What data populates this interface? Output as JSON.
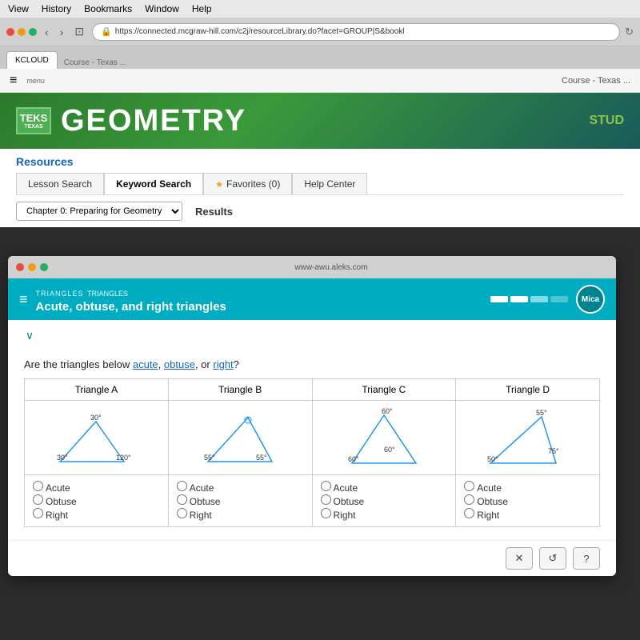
{
  "menubar": {
    "items": [
      "View",
      "History",
      "Bookmarks",
      "Window",
      "Help"
    ]
  },
  "browser": {
    "address": "https://connected.mcgraw-hill.com/c2j/resourceLibrary.do?facet=GROUP|S&bookl",
    "tab1": "KCLOUD",
    "tab2": "Course - Texas ..."
  },
  "mgh": {
    "menu_icon": "≡",
    "header_teks": "TEKS",
    "header_texas": "TEXAS",
    "header_title": "GEOMETRY",
    "header_stud": "STUD",
    "resources_label": "Resources",
    "tabs": [
      {
        "label": "Lesson Search",
        "active": false
      },
      {
        "label": "Keyword Search",
        "active": true
      },
      {
        "label": "Favorites (0)",
        "active": false
      },
      {
        "label": "Help Center",
        "active": false
      }
    ],
    "chapter": "Chapter 0: Preparing for Geometry",
    "results": "Results"
  },
  "aleks": {
    "url": "www-awu.aleks.com",
    "topic_label": "TRIANGLES",
    "topic_title": "Acute, obtuse, and right triangles",
    "avatar_text": "Mica",
    "question": "Are the triangles below",
    "question_links": [
      "acute",
      "obtuse",
      "right"
    ],
    "question_suffix": "?",
    "triangles": [
      {
        "label": "Triangle A",
        "angles": [
          "30°",
          "30°",
          "120°"
        ],
        "type": "obtuse"
      },
      {
        "label": "Triangle B",
        "angles": [
          "55°",
          "55°"
        ],
        "type": "acute"
      },
      {
        "label": "Triangle C",
        "angles": [
          "60°",
          "60°",
          "60°"
        ],
        "type": "acute"
      },
      {
        "label": "Triangle D",
        "angles": [
          "55°",
          "75°",
          "50°"
        ],
        "type": "acute"
      }
    ],
    "radio_options": [
      "Acute",
      "Obtuse",
      "Right"
    ],
    "buttons": {
      "cross": "✕",
      "undo": "↺",
      "help": "?"
    }
  }
}
